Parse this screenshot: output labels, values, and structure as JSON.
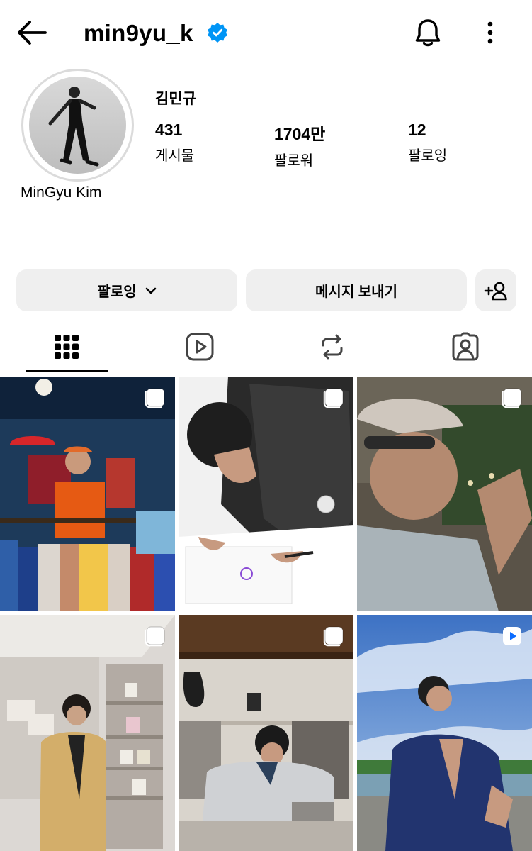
{
  "header": {
    "username": "min9yu_k"
  },
  "profile": {
    "full_name": "김민규",
    "display_name": "MinGyu Kim",
    "stats": [
      {
        "value": "431",
        "label": "게시물"
      },
      {
        "value": "1704만",
        "label": "팔로워"
      },
      {
        "value": "12",
        "label": "팔로잉"
      }
    ]
  },
  "buttons": {
    "following": "팔로잉",
    "message": "메시지 보내기"
  },
  "tabs": [
    "posts-grid",
    "reels",
    "reposts",
    "tagged"
  ],
  "colors": {
    "verified": "#0095f6",
    "button_bg": "#efefef",
    "divider": "#dbdbdb"
  },
  "posts": [
    {
      "type": "carousel"
    },
    {
      "type": "carousel"
    },
    {
      "type": "carousel"
    },
    {
      "type": "carousel"
    },
    {
      "type": "carousel"
    },
    {
      "type": "reel"
    }
  ]
}
